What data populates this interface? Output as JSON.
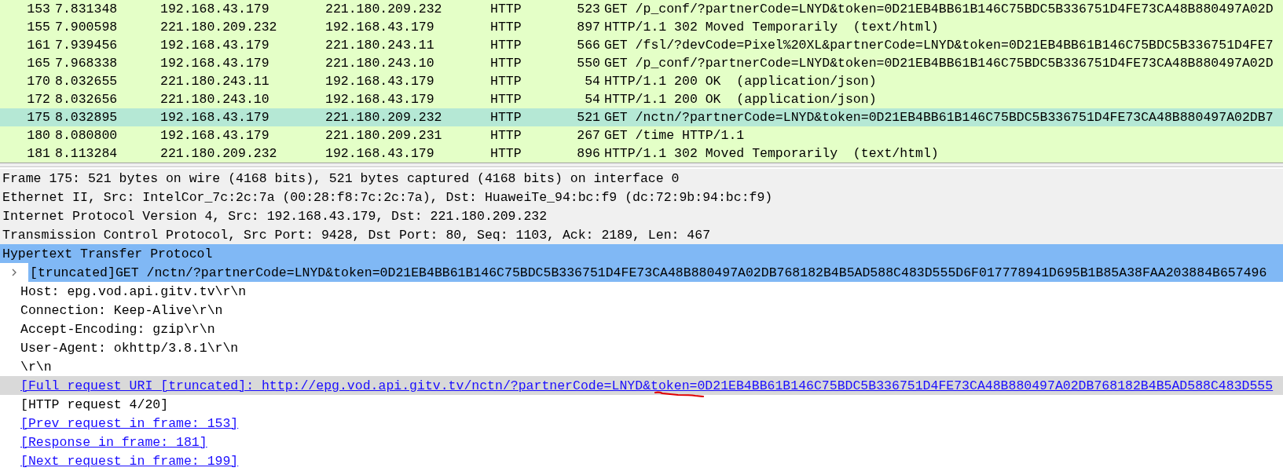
{
  "packet_list": {
    "rows": [
      {
        "no": "153",
        "time": "7.831348",
        "source": "192.168.43.179",
        "destination": "221.180.209.232",
        "protocol": "HTTP",
        "length": "523",
        "info": "GET /p_conf/?partnerCode=LNYD&token=0D21EB4BB61B146C75BDC5B336751D4FE73CA48B880497A02D",
        "selected": false
      },
      {
        "no": "155",
        "time": "7.900598",
        "source": "221.180.209.232",
        "destination": "192.168.43.179",
        "protocol": "HTTP",
        "length": "897",
        "info": "HTTP/1.1 302 Moved Temporarily  (text/html)",
        "selected": false
      },
      {
        "no": "161",
        "time": "7.939456",
        "source": "192.168.43.179",
        "destination": "221.180.243.11",
        "protocol": "HTTP",
        "length": "566",
        "info": "GET /fsl/?devCode=Pixel%20XL&partnerCode=LNYD&token=0D21EB4BB61B146C75BDC5B336751D4FE7",
        "selected": false
      },
      {
        "no": "165",
        "time": "7.968338",
        "source": "192.168.43.179",
        "destination": "221.180.243.10",
        "protocol": "HTTP",
        "length": "550",
        "info": "GET /p_conf/?partnerCode=LNYD&token=0D21EB4BB61B146C75BDC5B336751D4FE73CA48B880497A02D",
        "selected": false
      },
      {
        "no": "170",
        "time": "8.032655",
        "source": "221.180.243.11",
        "destination": "192.168.43.179",
        "protocol": "HTTP",
        "length": "54",
        "info": "HTTP/1.1 200 OK  (application/json)",
        "selected": false
      },
      {
        "no": "172",
        "time": "8.032656",
        "source": "221.180.243.10",
        "destination": "192.168.43.179",
        "protocol": "HTTP",
        "length": "54",
        "info": "HTTP/1.1 200 OK  (application/json)",
        "selected": false
      },
      {
        "no": "175",
        "time": "8.032895",
        "source": "192.168.43.179",
        "destination": "221.180.209.232",
        "protocol": "HTTP",
        "length": "521",
        "info": "GET /nctn/?partnerCode=LNYD&token=0D21EB4BB61B146C75BDC5B336751D4FE73CA48B880497A02DB7",
        "selected": true
      },
      {
        "no": "180",
        "time": "8.080800",
        "source": "192.168.43.179",
        "destination": "221.180.209.231",
        "protocol": "HTTP",
        "length": "267",
        "info": "GET /time HTTP/1.1",
        "selected": false
      },
      {
        "no": "181",
        "time": "8.113284",
        "source": "221.180.209.232",
        "destination": "192.168.43.179",
        "protocol": "HTTP",
        "length": "896",
        "info": "HTTP/1.1 302 Moved Temporarily  (text/html)",
        "selected": false
      }
    ]
  },
  "packet_details": {
    "items": [
      {
        "text": "Frame 175: 521 bytes on wire (4168 bits), 521 bytes captured (4168 bits) on interface 0",
        "selected": false
      },
      {
        "text": "Ethernet II, Src: IntelCor_7c:2c:7a (00:28:f8:7c:2c:7a), Dst: HuaweiTe_94:bc:f9 (dc:72:9b:94:bc:f9)",
        "selected": false
      },
      {
        "text": "Internet Protocol Version 4, Src: 192.168.43.179, Dst: 221.180.209.232",
        "selected": false
      },
      {
        "text": "Transmission Control Protocol, Src Port: 9428, Dst Port: 80, Seq: 1103, Ack: 2189, Len: 467",
        "selected": false
      },
      {
        "text": "Hypertext Transfer Protocol",
        "selected": true,
        "children": [
          {
            "kind": "field",
            "text": "[truncated]GET /nctn/?partnerCode=LNYD&token=0D21EB4BB61B146C75BDC5B336751D4FE73CA48B880497A02DB768182B4B5AD588C483D555D6F017778941D695B1B85A38FAA203884B657496",
            "highlighted": true,
            "hovered": false,
            "expanded": false
          },
          {
            "kind": "text",
            "text": "Host: epg.vod.api.gitv.tv\\r\\n",
            "highlighted": false,
            "hovered": false
          },
          {
            "kind": "text",
            "text": "Connection: Keep-Alive\\r\\n",
            "highlighted": false,
            "hovered": false
          },
          {
            "kind": "text",
            "text": "Accept-Encoding: gzip\\r\\n",
            "highlighted": false,
            "hovered": false
          },
          {
            "kind": "text",
            "text": "User-Agent: okhttp/3.8.1\\r\\n",
            "highlighted": false,
            "hovered": false
          },
          {
            "kind": "text",
            "text": "\\r\\n",
            "highlighted": false,
            "hovered": false
          },
          {
            "kind": "link",
            "text": "[Full request URI [truncated]: http://epg.vod.api.gitv.tv/nctn/?partnerCode=LNYD&token=0D21EB4BB61B146C75BDC5B336751D4FE73CA48B880497A02DB768182B4B5AD588C483D555",
            "highlighted": false,
            "hovered": true,
            "annotated": true
          },
          {
            "kind": "text",
            "text": "[HTTP request 4/20]",
            "highlighted": false,
            "hovered": false
          },
          {
            "kind": "link",
            "text": "[Prev request in frame: 153]",
            "highlighted": false,
            "hovered": false
          },
          {
            "kind": "link",
            "text": "[Response in frame: 181]",
            "highlighted": false,
            "hovered": false
          },
          {
            "kind": "link",
            "text": "[Next request in frame: 199]",
            "highlighted": false,
            "hovered": false
          }
        ]
      }
    ]
  }
}
